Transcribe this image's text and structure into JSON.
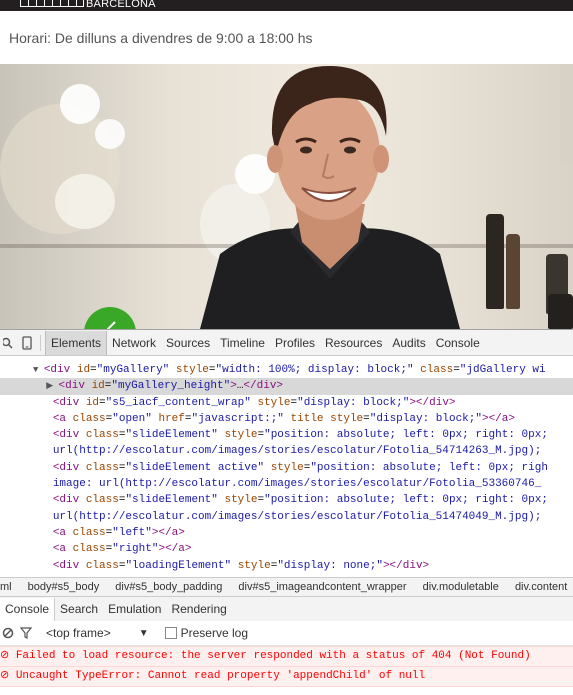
{
  "site": {
    "logo_text": "BARCELONA",
    "hours": "Horari: De dilluns a divendres de 9:00 a 18:00 hs",
    "colors": {
      "header_bg": "#231f20",
      "slider_arrow": "#3aa827"
    }
  },
  "devtools": {
    "tabs": [
      "Elements",
      "Network",
      "Sources",
      "Timeline",
      "Profiles",
      "Resources",
      "Audits",
      "Console"
    ],
    "active_tab": "Elements",
    "dom_lines": [
      {
        "indent": 0,
        "text": ""
      },
      {
        "indent": 5,
        "tri": "▼",
        "html": "<span class='tag'>&lt;div</span> <span class='attr'>id</span>=<span class='val'>\"myGallery\"</span> <span class='attr'>style</span>=<span class='val'>\"width: 100%; display: block;\"</span> <span class='attr'>class</span>=<span class='val'>\"jdGallery wi</span>"
      },
      {
        "indent": 7,
        "tri": "▶",
        "selected": true,
        "html": "<span class='tag'>&lt;div</span> <span class='attr'>id</span>=<span class='val'>\"myGallery_height\"</span><span class='tag'>&gt;</span><span class='txt'>…</span><span class='tag'>&lt;/div&gt;</span>"
      },
      {
        "indent": 8,
        "html": "<span class='tag'>&lt;div</span> <span class='attr'>id</span>=<span class='val'>\"s5_iacf_content_wrap\"</span> <span class='attr'>style</span>=<span class='val'>\"display: block;\"</span><span class='tag'>&gt;&lt;/div&gt;</span>"
      },
      {
        "indent": 8,
        "html": "<span class='tag'>&lt;a</span> <span class='attr'>class</span>=<span class='val'>\"open\"</span> <span class='attr'>href</span>=<span class='val'>\"javascript:;\"</span> <span class='attr'>title</span> <span class='attr'>style</span>=<span class='val'>\"display: block;\"</span><span class='tag'>&gt;&lt;/a&gt;</span>"
      },
      {
        "indent": 8,
        "html": "<span class='tag'>&lt;div</span> <span class='attr'>class</span>=<span class='val'>\"slideElement\"</span> <span class='attr'>style</span>=<span class='val'>\"position: absolute; left: 0px; right: 0px;</span>"
      },
      {
        "indent": 8,
        "html": "<span class='val'>url(http://escolatur.com/images/stories/escolatur/Fotolia_54714263_M.jpg);</span>"
      },
      {
        "indent": 8,
        "html": "<span class='tag'>&lt;div</span> <span class='attr'>class</span>=<span class='val'>\"slideElement active\"</span> <span class='attr'>style</span>=<span class='val'>\"position: absolute; left: 0px; righ</span>"
      },
      {
        "indent": 8,
        "html": "<span class='val'>image: url(http://escolatur.com/images/stories/escolatur/Fotolia_53360746_</span>"
      },
      {
        "indent": 8,
        "html": "<span class='tag'>&lt;div</span> <span class='attr'>class</span>=<span class='val'>\"slideElement\"</span> <span class='attr'>style</span>=<span class='val'>\"position: absolute; left: 0px; right: 0px;</span>"
      },
      {
        "indent": 8,
        "html": "<span class='val'>url(http://escolatur.com/images/stories/escolatur/Fotolia_51474049_M.jpg);</span>"
      },
      {
        "indent": 8,
        "html": "<span class='tag'>&lt;a</span> <span class='attr'>class</span>=<span class='val'>\"left\"</span><span class='tag'>&gt;&lt;/a&gt;</span>"
      },
      {
        "indent": 8,
        "html": "<span class='tag'>&lt;a</span> <span class='attr'>class</span>=<span class='val'>\"right\"</span><span class='tag'>&gt;&lt;/a&gt;</span>"
      },
      {
        "indent": 8,
        "html": "<span class='tag'>&lt;div</span> <span class='attr'>class</span>=<span class='val'>\"loadingElement\"</span> <span class='attr'>style</span>=<span class='val'>\"display: none;\"</span><span class='tag'>&gt;&lt;/div&gt;</span>"
      }
    ],
    "breadcrumbs": [
      "ml",
      "body#s5_body",
      "div#s5_body_padding",
      "div#s5_imageandcontent_wrapper",
      "div.moduletable",
      "div.content"
    ],
    "console_tabs": [
      "Console",
      "Search",
      "Emulation",
      "Rendering"
    ],
    "frame_select": "<top frame>",
    "preserve_log_label": "Preserve log",
    "preserve_log_checked": false,
    "errors": [
      "Failed to load resource: the server responded with a status of 404 (Not Found)",
      "Uncaught TypeError: Cannot read property 'appendChild' of null"
    ]
  }
}
